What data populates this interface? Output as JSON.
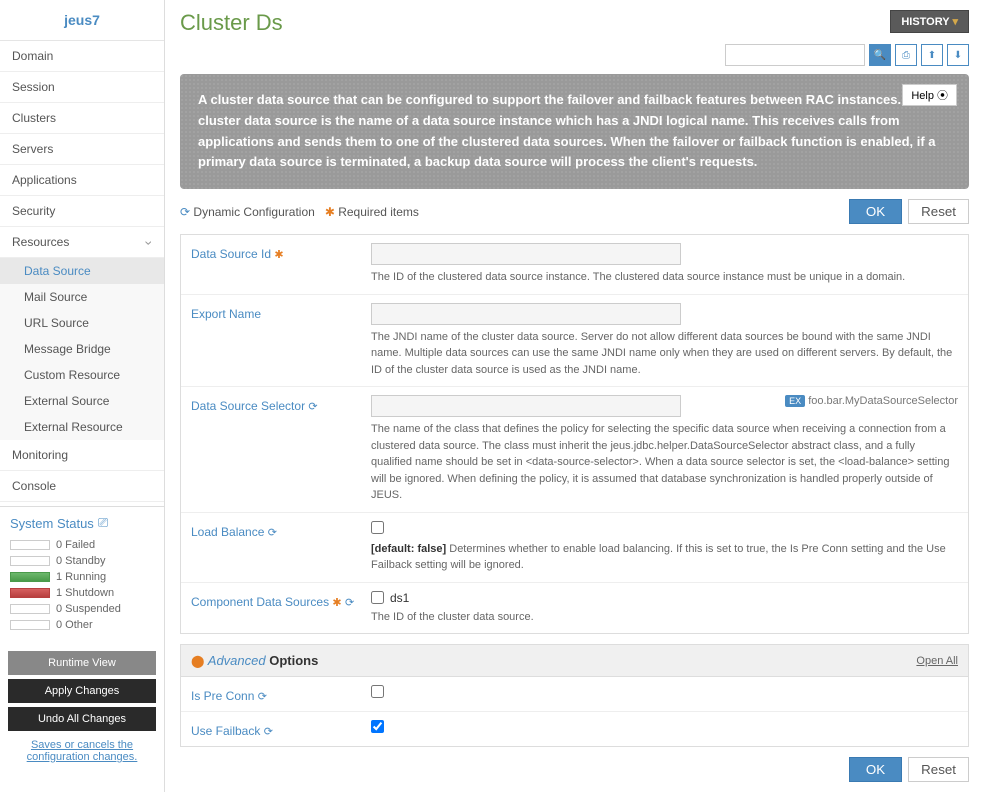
{
  "logo": "jeus7",
  "nav": {
    "domain": "Domain",
    "session": "Session",
    "clusters": "Clusters",
    "servers": "Servers",
    "applications": "Applications",
    "security": "Security",
    "resources": "Resources"
  },
  "subnav": {
    "datasource": "Data Source",
    "mailsource": "Mail Source",
    "urlsource": "URL Source",
    "messagebridge": "Message Bridge",
    "customresource": "Custom Resource",
    "externalsource": "External Source",
    "externalresource": "External Resource"
  },
  "nav2": {
    "monitoring": "Monitoring",
    "console": "Console"
  },
  "status": {
    "title": "System Status",
    "failed": "0  Failed",
    "standby": "0  Standby",
    "running": "1  Running",
    "shutdown": "1  Shutdown",
    "suspended": "0  Suspended",
    "other": "0  Other"
  },
  "buttons": {
    "runtime": "Runtime View",
    "apply": "Apply Changes",
    "undo": "Undo All Changes",
    "savelink": "Saves or cancels the configuration changes."
  },
  "header": {
    "title": "Cluster Ds",
    "history": "HISTORY",
    "help": "Help ⦿"
  },
  "info": "A cluster data source that can be configured to support the failover and failback features between RAC instances. The cluster data source is the name of a data source instance which has a JNDI logical name. This receives calls from applications and sends them to one of the clustered data sources. When the failover or failback function is enabled, if a primary data source is terminated, a backup data source will process the client's requests.",
  "legend": {
    "dynamic": "Dynamic Configuration",
    "required": "Required items",
    "ok": "OK",
    "reset": "Reset"
  },
  "fields": {
    "dsid": {
      "label": "Data Source Id",
      "desc": "The ID of the clustered data source instance. The clustered data source instance must be unique in a domain."
    },
    "export": {
      "label": "Export Name",
      "desc": "The JNDI name of the cluster data source. Server do not allow different data sources be bound with the same JNDI name. Multiple data sources can use the same JNDI name only when they are used on different servers. By default, the ID of the cluster data source is used as the JNDI name."
    },
    "selector": {
      "label": "Data Source Selector",
      "example": "foo.bar.MyDataSourceSelector",
      "desc": "The name of the class that defines the policy for selecting the specific data source when receiving a connection from a clustered data source. The class must inherit the jeus.jdbc.helper.DataSourceSelector abstract class, and a fully qualified name should be set in <data-source-selector>. When a data source selector is set, the <load-balance> setting will be ignored. When defining the policy, it is assumed that database synchronization is handled properly outside of JEUS."
    },
    "loadbal": {
      "label": "Load Balance",
      "default": "[default: false]",
      "desc": "  Determines whether to enable load balancing. If this is set to true, the Is Pre Conn setting and the Use Failback setting will be ignored."
    },
    "compds": {
      "label": "Component Data Sources",
      "option": "ds1",
      "desc": "The ID of the cluster data source."
    }
  },
  "advanced": {
    "title": "Advanced",
    "options": " Options",
    "openall": "Open All",
    "preconn": "Is Pre Conn",
    "failback": "Use Failback"
  }
}
